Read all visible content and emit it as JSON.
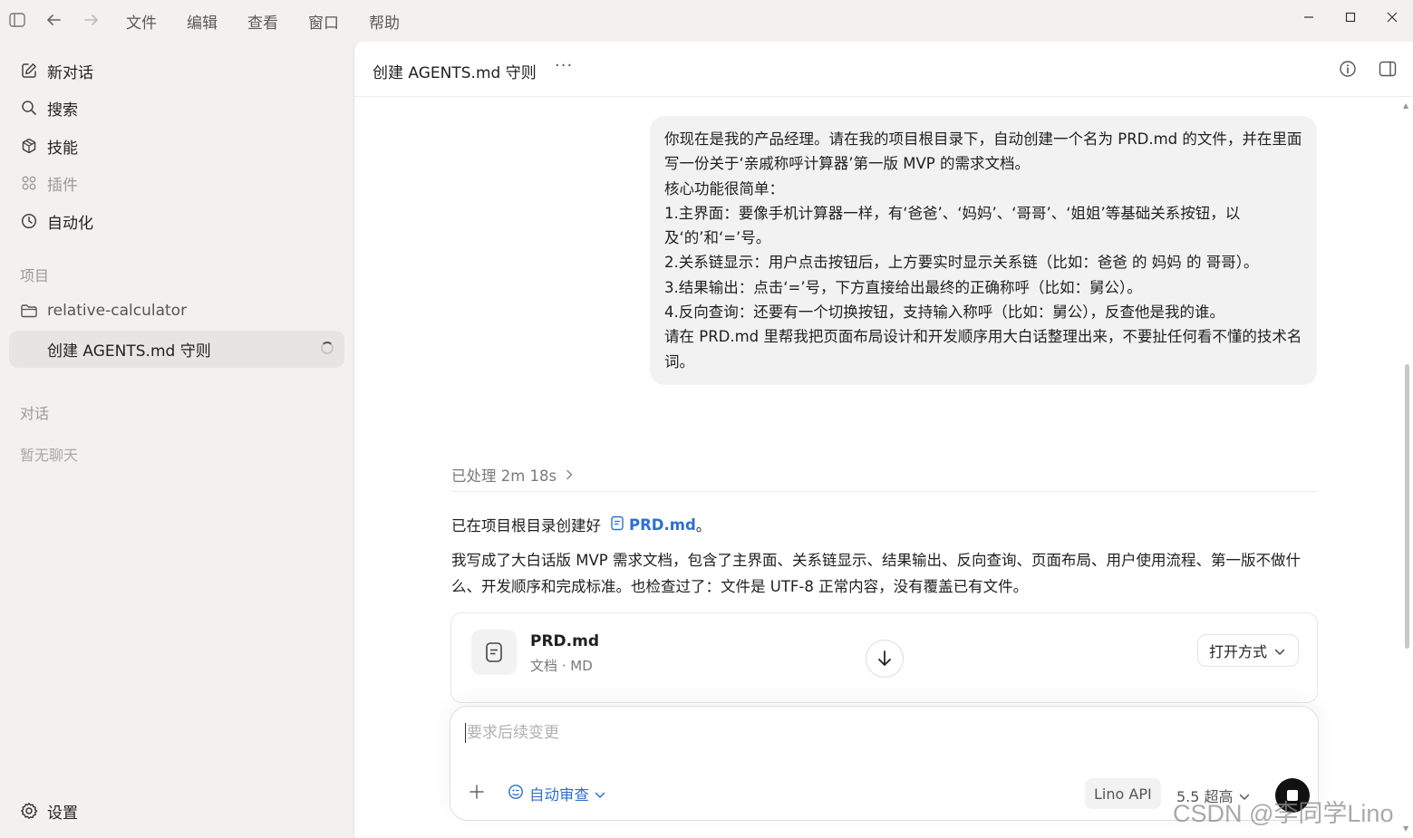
{
  "menu": {
    "items": [
      "文件",
      "编辑",
      "查看",
      "窗口",
      "帮助"
    ]
  },
  "sidebar": {
    "items": [
      {
        "label": "新对话",
        "icon": "edit-icon"
      },
      {
        "label": "搜索",
        "icon": "search-icon"
      },
      {
        "label": "技能",
        "icon": "skills-icon"
      },
      {
        "label": "插件",
        "icon": "plugins-icon"
      },
      {
        "label": "自动化",
        "icon": "clock-icon"
      }
    ],
    "projects_heading": "项目",
    "project_name": "relative-calculator",
    "active_thread": "创建 AGENTS.md 守则",
    "conversations_heading": "对话",
    "no_chats": "暂无聊天",
    "settings_label": "设置"
  },
  "header": {
    "title": "创建 AGENTS.md 守则",
    "more": "···"
  },
  "message": {
    "lines": [
      "你现在是我的产品经理。请在我的项目根目录下，自动创建一个名为 PRD.md 的文件，并在里面写一份关于‘亲戚称呼计算器’第一版 MVP 的需求文档。",
      "核心功能很简单：",
      "1.主界面：要像手机计算器一样，有‘爸爸’、‘妈妈’、‘哥哥’、‘姐姐’等基础关系按钮，以及‘的’和‘=’号。",
      "2.关系链显示：用户点击按钮后，上方要实时显示关系链（比如：爸爸 的 妈妈 的 哥哥）。",
      "3.结果输出：点击‘=’号，下方直接给出最终的正确称呼（比如：舅公）。",
      "4.反向查询：还要有一个切换按钮，支持输入称呼（比如：舅公），反查他是我的谁。",
      "请在 PRD.md 里帮我把页面布局设计和开发顺序用大白话整理出来，不要扯任何看不懂的技术名词。"
    ]
  },
  "reply": {
    "processed": "已处理 2m 18s",
    "created_prefix": "已在项目根目录创建好",
    "file_link": "PRD.md",
    "created_suffix": "。",
    "summary": "我写成了大白话版 MVP 需求文档，包含了主界面、关系链显示、结果输出、反向查询、页面布局、用户使用流程、第一版不做什么、开发顺序和完成标准。也检查过了：文件是 UTF-8 正常内容，没有覆盖已有文件。"
  },
  "file_card": {
    "name": "PRD.md",
    "meta": "文档 · MD",
    "open_with": "打开方式"
  },
  "composer": {
    "placeholder": "要求后续变更",
    "review_mode": "自动审查",
    "api": "Lino API",
    "model": "5.5 超高"
  },
  "watermark": "CSDN @李同学Lino",
  "colors": {
    "accent": "#2e6fd1",
    "sidebar_bg": "#f3f1ef",
    "bubble_bg": "#f2f2f2"
  }
}
